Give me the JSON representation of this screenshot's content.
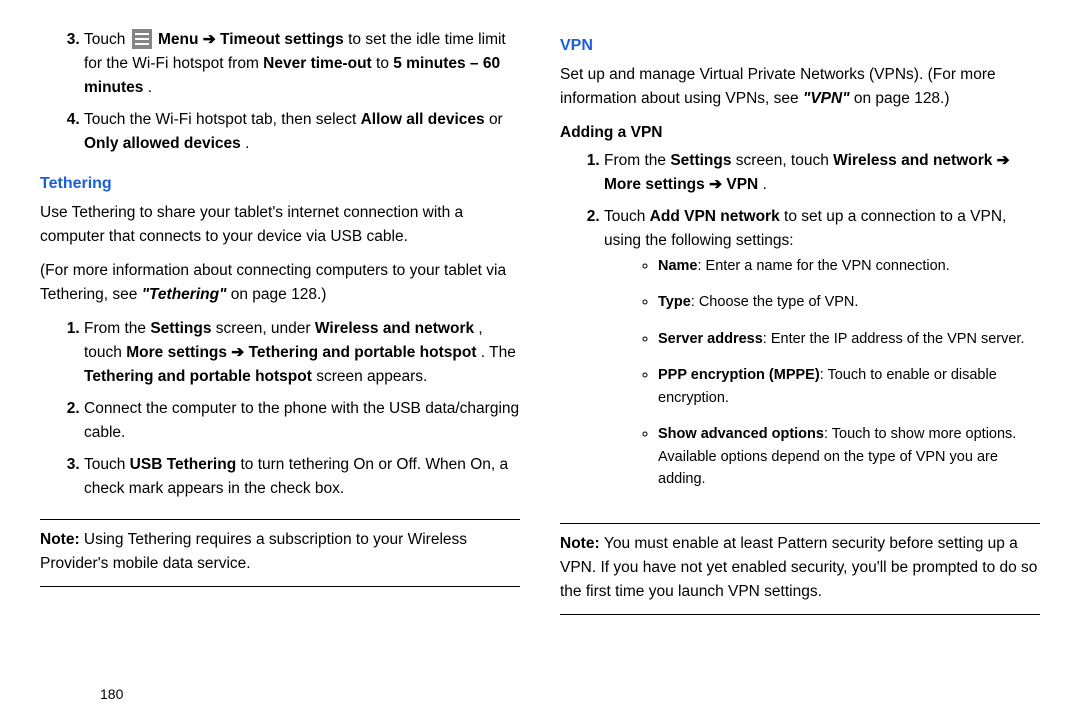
{
  "left": {
    "step3_a": "Touch ",
    "step3_b": " Menu ➔ Timeout settings",
    "step3_c": " to set the idle time limit for the Wi-Fi hotspot from ",
    "step3_d": "Never time-out",
    "step3_e": " to ",
    "step3_f": "5 minutes – 60 minutes",
    "step3_g": ".",
    "step4_a": "Touch the Wi-Fi hotspot tab, then select ",
    "step4_b": "Allow all devices",
    "step4_c": " or ",
    "step4_d": "Only allowed devices",
    "step4_e": ".",
    "tethering_heading": "Tethering",
    "tethering_p1": "Use Tethering to share your tablet's internet connection with a computer that connects to your device via USB cable.",
    "tethering_p2_a": "(For more information about connecting computers to your tablet via Tethering, see ",
    "tethering_p2_b": "\"Tethering\"",
    "tethering_p2_c": " on page 128.)",
    "t1_a": "From the ",
    "t1_b": "Settings",
    "t1_c": " screen, under ",
    "t1_d": "Wireless and network",
    "t1_e": ", touch ",
    "t1_f": "More settings ➔ Tethering and portable hotspot",
    "t1_g": " . The ",
    "t1_h": "Tethering and portable hotspot",
    "t1_i": " screen appears.",
    "t2": "Connect the computer to the phone with the USB data/charging cable.",
    "t3_a": "Touch ",
    "t3_b": "USB Tethering",
    "t3_c": " to turn tethering On or Off. When On, a check mark appears in the check box.",
    "note_hdr": "Note: ",
    "note_body": "Using Tethering requires a subscription to your Wireless Provider's mobile data service."
  },
  "right": {
    "vpn_heading": "VPN",
    "vpn_p_a": "Set up and manage Virtual Private Networks (VPNs).  (For more information about using VPNs, see ",
    "vpn_p_b": "\"VPN\"",
    "vpn_p_c": " on page 128.)",
    "add_heading": "Adding a VPN",
    "v1_a": "From the ",
    "v1_b": "Settings",
    "v1_c": " screen, touch ",
    "v1_d": "Wireless and network ➔ More settings  ➔ VPN",
    "v1_e": ".",
    "v2_a": "Touch ",
    "v2_b": "Add VPN network",
    "v2_c": " to set up a connection to a VPN, using the following settings:",
    "b1_a": "Name",
    "b1_b": ": Enter a name for the VPN connection.",
    "b2_a": "Type",
    "b2_b": ": Choose the type of VPN.",
    "b3_a": "Server address",
    "b3_b": ": Enter the IP address of the VPN server.",
    "b4_a": "PPP encryption (MPPE)",
    "b4_b": ": Touch to enable or disable encryption.",
    "b5_a": "Show advanced options",
    "b5_b": ": Touch to show more options. Available options depend on the type of VPN you are adding.",
    "note_hdr": "Note: ",
    "note_body": "You must enable at least Pattern security before setting up a VPN. If you have not yet enabled security, you'll be prompted to do so the first time you launch VPN settings."
  },
  "page_number": "180"
}
